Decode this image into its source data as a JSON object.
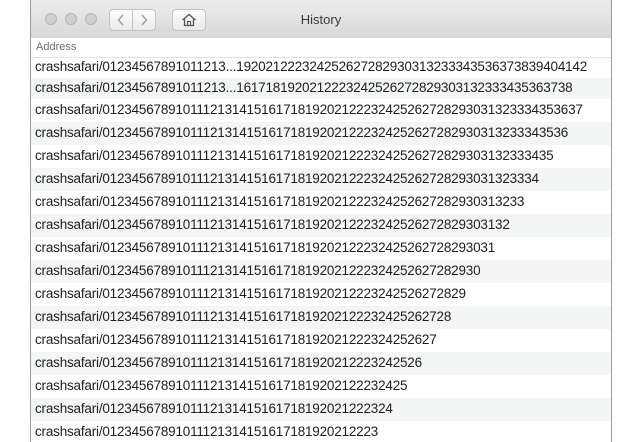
{
  "window": {
    "title": "History"
  },
  "table": {
    "column_header": "Address"
  },
  "rows": [
    "crashsafari/01234567891011213...192021222324252627282930313233343536373839404142",
    "crashsafari/01234567891011213...1617181920212223242526272829303132333435363738",
    "crashsafari/012345678910111213141516171819202122232425262728293031323334353637",
    "crashsafari/0123456789101112131415161718192021222324252627282930313233343536",
    "crashsafari/01234567891011121314151617181920212223242526272829303132333435",
    "crashsafari/012345678910111213141516171819202122232425262728293031323334",
    "crashsafari/0123456789101112131415161718192021222324252627282930313233",
    "crashsafari/01234567891011121314151617181920212223242526272829303132",
    "crashsafari/012345678910111213141516171819202122232425262728293031",
    "crashsafari/0123456789101112131415161718192021222324252627282930",
    "crashsafari/01234567891011121314151617181920212223242526272829",
    "crashsafari/012345678910111213141516171819202122232425262728",
    "crashsafari/0123456789101112131415161718192021222324252627",
    "crashsafari/01234567891011121314151617181920212223242526",
    "crashsafari/012345678910111213141516171819202122232425",
    "crashsafari/0123456789101112131415161718192021222324",
    "crashsafari/01234567891011121314151617181920212223"
  ]
}
